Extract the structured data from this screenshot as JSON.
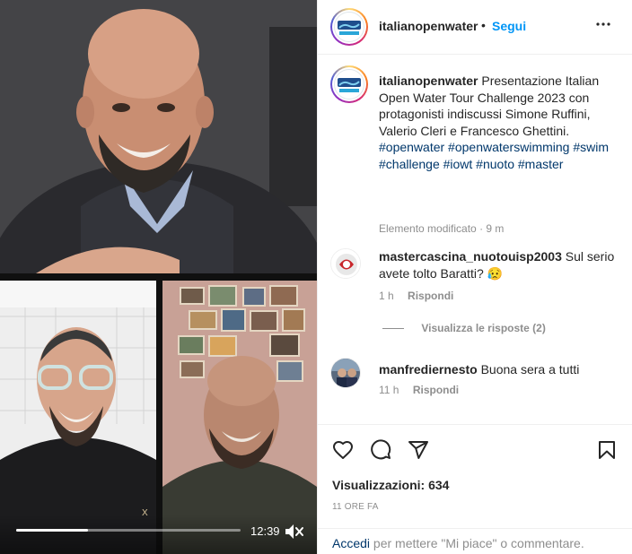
{
  "post": {
    "username": "italianopenwater",
    "follow_label": "Segui",
    "caption": "Presentazione Italian Open Water Tour Challenge 2023 con protagonisti indiscussi Simone Ruffini, Valerio Cleri e Francesco Ghettini.",
    "hashtags": "#openwater #openwaterswimming #swim #challenge #iowt #nuoto #master",
    "edited_label": "Elemento modificato",
    "edited_time": "9 m"
  },
  "comments": [
    {
      "username": "mastercascina_nuotouisp2003",
      "text": "Sul serio avete tolto Baratti? 😥",
      "time": "1 h",
      "reply_label": "Rispondi",
      "view_replies": "Visualizza le risposte (2)"
    },
    {
      "username": "manfrediernesto",
      "text": "Buona sera a tutti",
      "time": "11 h",
      "reply_label": "Rispondi"
    }
  ],
  "stats": {
    "views_label": "Visualizzazioni:",
    "views_count": "634",
    "time_ago": "11 ORE FA"
  },
  "login": {
    "link_label": "Accedi",
    "text": "per mettere \"Mi piace\" o commentare."
  },
  "video": {
    "time": "12:39",
    "progress": 0.32
  },
  "icons": {
    "more": "more-horizontal-icon",
    "like": "heart-icon",
    "comment": "comment-bubble-icon",
    "share": "send-plane-icon",
    "save": "bookmark-icon",
    "mute": "speaker-muted-icon"
  },
  "colors": {
    "link_blue": "#0095f6",
    "hashtag_blue": "#00376b",
    "muted_gray": "#8e8e8e"
  }
}
